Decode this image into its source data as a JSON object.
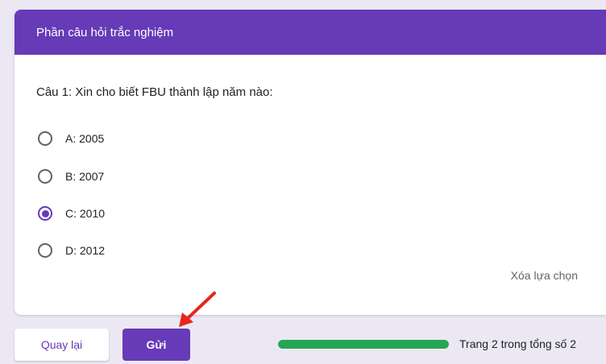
{
  "header": {
    "title": "Phần câu hỏi trắc nghiệm"
  },
  "question": {
    "text": "Câu 1: Xin cho biết FBU thành lập năm nào:",
    "options": [
      {
        "label": "A: 2005",
        "selected": false
      },
      {
        "label": "B: 2007",
        "selected": false
      },
      {
        "label": "C: 2010",
        "selected": true
      },
      {
        "label": "D: 2012",
        "selected": false
      }
    ],
    "clear_label": "Xóa lựa chọn"
  },
  "footer": {
    "back_label": "Quay lại",
    "submit_label": "Gửi",
    "progress_fraction": 1.0,
    "page_indicator": "Trang 2 trong tổng số 2"
  },
  "colors": {
    "accent": "#673ab7",
    "progress": "#27a555",
    "annotation_arrow": "#e8261c"
  },
  "annotations": {
    "arrow_icon": "red-arrow-icon"
  }
}
